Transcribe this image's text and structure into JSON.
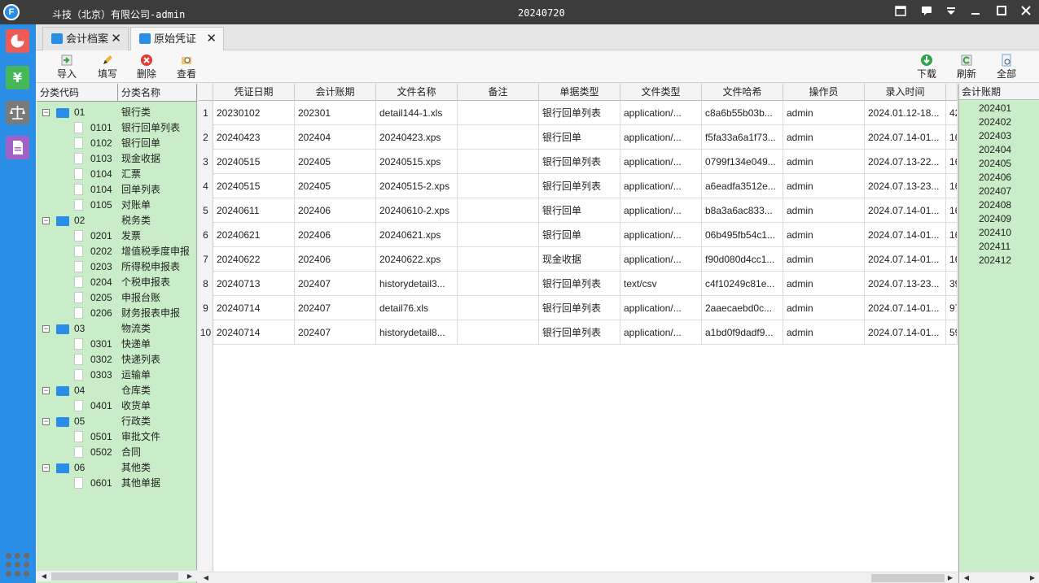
{
  "titlebar": {
    "company": "斗技（北京）有限公司-admin",
    "date": "20240720",
    "logo_letter": "F"
  },
  "tabs": [
    {
      "label": "会计档案",
      "close": "✕"
    },
    {
      "label": "原始凭证",
      "close": "✕"
    }
  ],
  "toolbar": {
    "import": "导入",
    "fill": "填写",
    "delete": "删除",
    "view": "查看",
    "download": "下载",
    "refresh": "刷新",
    "all": "全部"
  },
  "category": {
    "head_code": "分类代码",
    "head_name": "分类名称",
    "groups": [
      {
        "code": "01",
        "name": "银行类",
        "children": [
          {
            "code": "0101",
            "name": "银行回单列表"
          },
          {
            "code": "0102",
            "name": "银行回单"
          },
          {
            "code": "0103",
            "name": "现金收据"
          },
          {
            "code": "0104",
            "name": "汇票"
          },
          {
            "code": "0104",
            "name": "回单列表"
          },
          {
            "code": "0105",
            "name": "对账单"
          }
        ]
      },
      {
        "code": "02",
        "name": "税务类",
        "children": [
          {
            "code": "0201",
            "name": "发票"
          },
          {
            "code": "0202",
            "name": "增值税季度申报"
          },
          {
            "code": "0203",
            "name": "所得税申报表"
          },
          {
            "code": "0204",
            "name": "个税申报表"
          },
          {
            "code": "0205",
            "name": "申报台账"
          },
          {
            "code": "0206",
            "name": "财务报表申报"
          }
        ]
      },
      {
        "code": "03",
        "name": "物流类",
        "children": [
          {
            "code": "0301",
            "name": "快递单"
          },
          {
            "code": "0302",
            "name": "快递列表"
          },
          {
            "code": "0303",
            "name": "运输单"
          }
        ]
      },
      {
        "code": "04",
        "name": "仓库类",
        "children": [
          {
            "code": "0401",
            "name": "收货单"
          }
        ]
      },
      {
        "code": "05",
        "name": "行政类",
        "children": [
          {
            "code": "0501",
            "name": "审批文件"
          },
          {
            "code": "0502",
            "name": "合同"
          }
        ]
      },
      {
        "code": "06",
        "name": "其他类",
        "children": [
          {
            "code": "0601",
            "name": "其他单据"
          }
        ]
      }
    ]
  },
  "grid": {
    "columns": [
      "凭证日期",
      "会计账期",
      "文件名称",
      "备注",
      "单据类型",
      "文件类型",
      "文件哈希",
      "操作员",
      "录入时间"
    ],
    "rows": [
      {
        "n": "1",
        "date": "20230102",
        "period": "202301",
        "file": "detail144-1.xls",
        "note": "",
        "doc_type": "银行回单列表",
        "mime": "application/...",
        "hash": "c8a6b55b03b...",
        "op": "admin",
        "time": "2024.01.12-18...",
        "extra": "42"
      },
      {
        "n": "2",
        "date": "20240423",
        "period": "202404",
        "file": "20240423.xps",
        "note": "",
        "doc_type": "银行回单",
        "mime": "application/...",
        "hash": "f5fa33a6a1f73...",
        "op": "admin",
        "time": "2024.07.14-01...",
        "extra": "16"
      },
      {
        "n": "3",
        "date": "20240515",
        "period": "202405",
        "file": "20240515.xps",
        "note": "",
        "doc_type": "银行回单列表",
        "mime": "application/...",
        "hash": "0799f134e049...",
        "op": "admin",
        "time": "2024.07.13-22...",
        "extra": "16"
      },
      {
        "n": "4",
        "date": "20240515",
        "period": "202405",
        "file": "20240515-2.xps",
        "note": "",
        "doc_type": "银行回单列表",
        "mime": "application/...",
        "hash": "a6eadfa3512e...",
        "op": "admin",
        "time": "2024.07.13-23...",
        "extra": "16"
      },
      {
        "n": "5",
        "date": "20240611",
        "period": "202406",
        "file": "20240610-2.xps",
        "note": "",
        "doc_type": "银行回单",
        "mime": "application/...",
        "hash": "b8a3a6ac833...",
        "op": "admin",
        "time": "2024.07.14-01...",
        "extra": "16"
      },
      {
        "n": "6",
        "date": "20240621",
        "period": "202406",
        "file": "20240621.xps",
        "note": "",
        "doc_type": "银行回单",
        "mime": "application/...",
        "hash": "06b495fb54c1...",
        "op": "admin",
        "time": "2024.07.14-01...",
        "extra": "16"
      },
      {
        "n": "7",
        "date": "20240622",
        "period": "202406",
        "file": "20240622.xps",
        "note": "",
        "doc_type": "现金收据",
        "mime": "application/...",
        "hash": "f90d080d4cc1...",
        "op": "admin",
        "time": "2024.07.14-01...",
        "extra": "16"
      },
      {
        "n": "8",
        "date": "20240713",
        "period": "202407",
        "file": "historydetail3...",
        "note": "",
        "doc_type": "银行回单列表",
        "mime": "text/csv",
        "hash": "c4f10249c81e...",
        "op": "admin",
        "time": "2024.07.13-23...",
        "extra": "39"
      },
      {
        "n": "9",
        "date": "20240714",
        "period": "202407",
        "file": "detail76.xls",
        "note": "",
        "doc_type": "银行回单列表",
        "mime": "application/...",
        "hash": "2aaecaebd0c...",
        "op": "admin",
        "time": "2024.07.14-01...",
        "extra": "97"
      },
      {
        "n": "10",
        "date": "20240714",
        "period": "202407",
        "file": "historydetail8...",
        "note": "",
        "doc_type": "银行回单列表",
        "mime": "application/...",
        "hash": "a1bd0f9dadf9...",
        "op": "admin",
        "time": "2024.07.14-01...",
        "extra": "59"
      }
    ]
  },
  "period": {
    "head": "会计账期",
    "items": [
      "202401",
      "202402",
      "202403",
      "202404",
      "202405",
      "202406",
      "202407",
      "202408",
      "202409",
      "202410",
      "202411",
      "202412"
    ]
  },
  "colors": {
    "accent": "#2a8de6",
    "panel_green": "#c8edc8",
    "titlebar": "#3c3c3c"
  }
}
